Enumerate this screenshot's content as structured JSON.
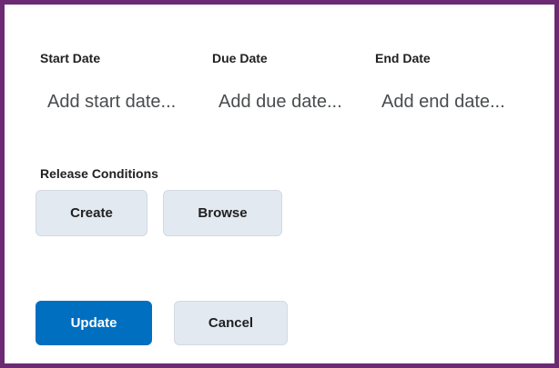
{
  "dates": {
    "start": {
      "label": "Start Date",
      "placeholder": "Add start date..."
    },
    "due": {
      "label": "Due Date",
      "placeholder": "Add due date..."
    },
    "end": {
      "label": "End Date",
      "placeholder": "Add end date..."
    }
  },
  "release_conditions": {
    "label": "Release Conditions",
    "create_label": "Create",
    "browse_label": "Browse"
  },
  "actions": {
    "update_label": "Update",
    "cancel_label": "Cancel"
  },
  "colors": {
    "frame_border": "#6b2a72",
    "primary_button": "#006fbf",
    "secondary_button": "#e3e9f1"
  }
}
